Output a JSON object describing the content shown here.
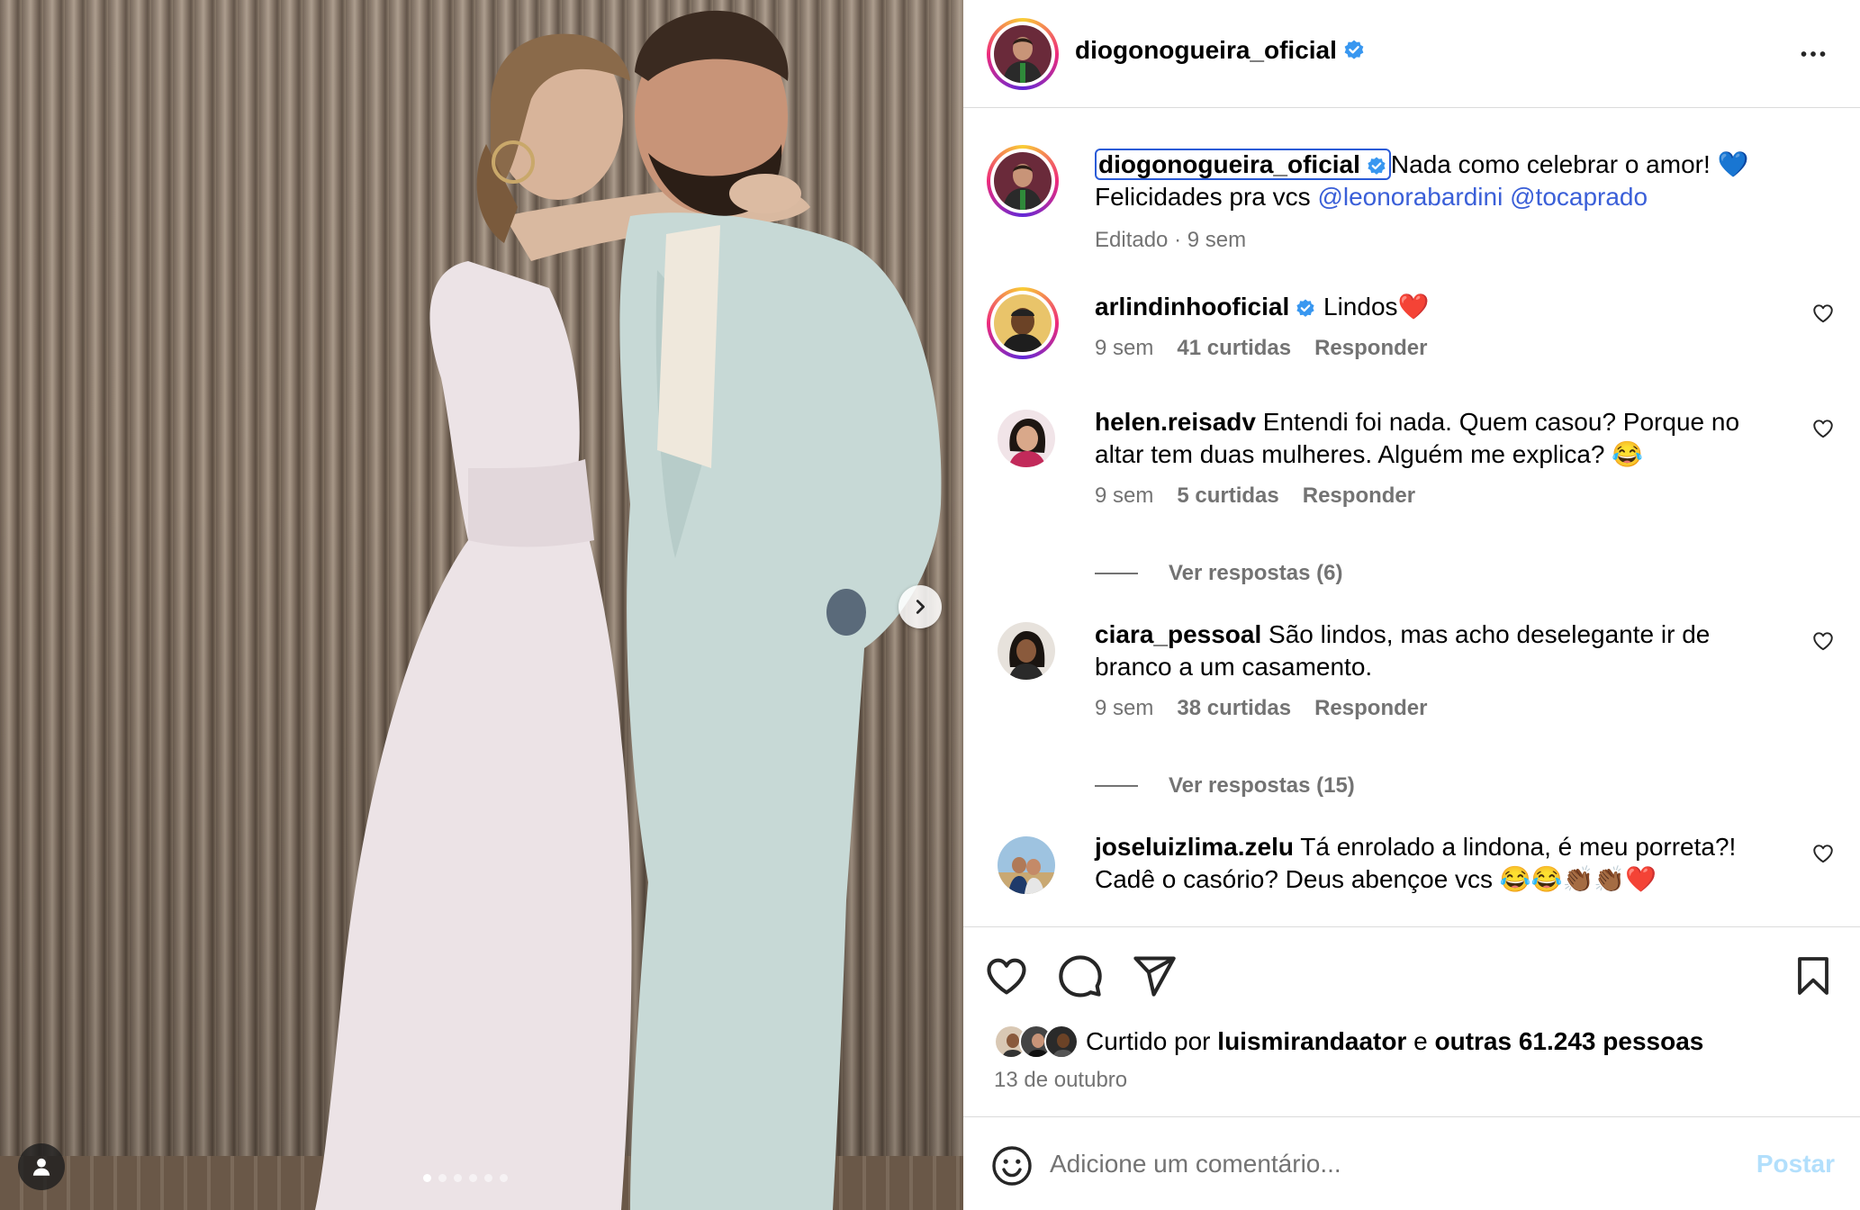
{
  "header": {
    "username": "diogonogueira_oficial",
    "more_icon": "more-horizontal-icon"
  },
  "caption": {
    "username": "diogonogueira_oficial",
    "text_1": "Nada como celebrar o amor! 💙",
    "text_2": "Felicidades pra vcs",
    "mention_1": "@leonorabardini",
    "mention_2": "@tocaprado",
    "edited": "Editado",
    "time": "9 sem"
  },
  "comments": [
    {
      "username": "arlindinhooficial",
      "verified": true,
      "text": "Lindos❤️",
      "time": "9 sem",
      "likes": "41 curtidas",
      "reply": "Responder"
    },
    {
      "username": "helen.reisadv",
      "verified": false,
      "text": "Entendi foi nada. Quem casou? Porque no altar tem duas mulheres. Alguém me explica? 😂",
      "time": "9 sem",
      "likes": "5 curtidas",
      "reply": "Responder",
      "view_replies": "Ver respostas (6)"
    },
    {
      "username": "ciara_pessoal",
      "verified": false,
      "text": "São lindos, mas acho deselegante ir de branco a um casamento.",
      "time": "9 sem",
      "likes": "38 curtidas",
      "reply": "Responder",
      "view_replies": "Ver respostas (15)"
    },
    {
      "username": "joseluizlima.zelu",
      "verified": false,
      "text": "Tá enrolado a lindona, é meu porreta?! Cadê o casório? Deus abençoe vcs 😂😂👏🏾👏🏾❤️"
    }
  ],
  "likes": {
    "prefix": "Curtido por",
    "user": "luismirandaator",
    "conj": "e",
    "others": "outras 61.243 pessoas"
  },
  "date": "13 de outubro",
  "add_comment": {
    "placeholder": "Adicione um comentário...",
    "post_label": "Postar"
  },
  "colors": {
    "verified": "#3897f0",
    "mention": "#3a5fd8",
    "post_button": "#b2dffc"
  },
  "carousel": {
    "slides": 6,
    "current": 1
  }
}
